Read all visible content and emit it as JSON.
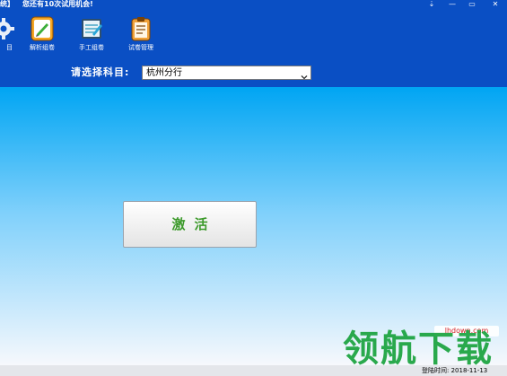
{
  "titlebar": {
    "title_fragment": "统】",
    "trial_message": "您还有10次试用机会!",
    "controls": {
      "extra": "⇣",
      "minimize": "—",
      "restore": "▭",
      "close": "✕"
    }
  },
  "toolbar": {
    "items": [
      {
        "label": "目",
        "icon": "gear-icon"
      },
      {
        "label": "解析组卷",
        "icon": "pen-paper-icon"
      },
      {
        "label": "手工组卷",
        "icon": "notebook-icon"
      },
      {
        "label": "试卷管理",
        "icon": "clipboard-icon"
      }
    ]
  },
  "subject": {
    "label": "请选择科目:",
    "selected": "杭州分行"
  },
  "main": {
    "activate_label": "激活"
  },
  "statusbar": {
    "login_time": "登陆时间: 2018-11-13"
  },
  "watermark": {
    "site": "lhdown.com",
    "text": "领航下载"
  },
  "colors": {
    "title_bg": "#0a4fc4",
    "main_top": "#00a5f3",
    "main_bottom": "#f6f8fc",
    "activate_text": "#3c9a2b"
  }
}
